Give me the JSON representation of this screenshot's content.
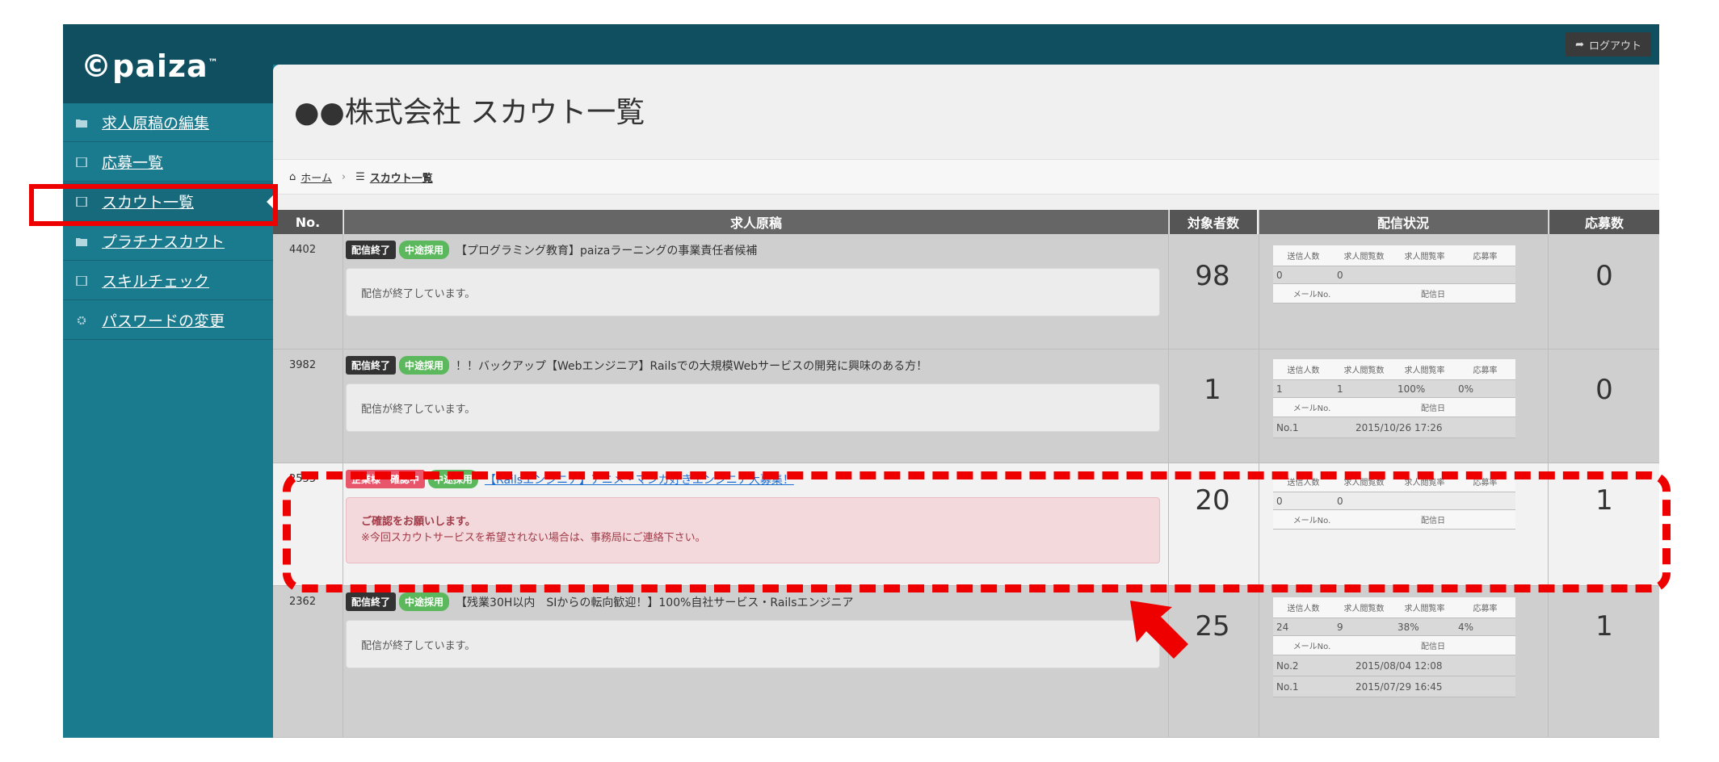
{
  "app": {
    "logo_text": "paiza",
    "logout_label": "ログアウト"
  },
  "sidebar": {
    "items": [
      {
        "label": "求人原稿の編集",
        "icon": "folder-icon"
      },
      {
        "label": "応募一覧",
        "icon": "list-icon"
      },
      {
        "label": "スカウト一覧",
        "icon": "list-icon"
      },
      {
        "label": "プラチナスカウト",
        "icon": "folder-icon"
      },
      {
        "label": "スキルチェック",
        "icon": "list-icon"
      },
      {
        "label": "パスワードの変更",
        "icon": "gear-icon"
      }
    ]
  },
  "page": {
    "title": "●●株式会社 スカウト一覧",
    "breadcrumb": {
      "home": "ホーム",
      "separator": "›",
      "current": "スカウト一覧"
    }
  },
  "table": {
    "headers": {
      "no": "No.",
      "job": "求人原稿",
      "targets": "対象者数",
      "delivery": "配信状況",
      "applications": "応募数"
    },
    "stat_headers": [
      "送信人数",
      "求人閲覧数",
      "求人閲覧率",
      "応募率"
    ],
    "stat_sub_headers": {
      "mail_no": "メールNo.",
      "date": "配信日"
    },
    "rows": [
      {
        "no": "4402",
        "badge1": "配信終了",
        "badge2": "中途採用",
        "title": "【プログラミング教育】paizaラーニングの事業責任者候補",
        "message": "配信が終了しています。",
        "targets": "98",
        "stats": [
          "0",
          "0",
          "",
          ""
        ],
        "history": [],
        "applications": "0"
      },
      {
        "no": "3982",
        "badge1": "配信終了",
        "badge2": "中途採用",
        "title": "！！バックアップ【Webエンジニア】Railsでの大規模Webサービスの開発に興味のある方！",
        "message": "配信が終了しています。",
        "targets": "1",
        "stats": [
          "1",
          "1",
          "100%",
          "0%"
        ],
        "history": [
          {
            "mail_no": "No.1",
            "date": "2015/10/26 17:26"
          }
        ],
        "applications": "0"
      },
      {
        "no": "2555",
        "badge1": "企業様　確認中",
        "badge2": "中途採用",
        "title": "【Railsエンジニア】アニメ・マンガ好きエンジニア大募集！",
        "message_bold": "ご確認をお願いします。",
        "message_note": "※今回スカウトサービスを希望されない場合は、事務局にご連絡下さい。",
        "targets": "20",
        "stats": [
          "0",
          "0",
          "",
          ""
        ],
        "history": [],
        "applications": "1"
      },
      {
        "no": "2362",
        "badge1": "配信終了",
        "badge2": "中途採用",
        "title": "【残業30H以内　SIからの転向歓迎！】100%自社サービス・Railsエンジニア",
        "message": "配信が終了しています。",
        "targets": "25",
        "stats": [
          "24",
          "9",
          "38%",
          "4%"
        ],
        "history": [
          {
            "mail_no": "No.2",
            "date": "2015/08/04 12:08"
          },
          {
            "mail_no": "No.1",
            "date": "2015/07/29 16:45"
          }
        ],
        "applications": "1"
      }
    ]
  },
  "colors": {
    "sidebar": "#1a7a8e",
    "topbar": "#0f4f60",
    "annotation": "#ee0000",
    "badge_end": "#333333",
    "badge_mid": "#5cb85c",
    "badge_confirm": "#e8566b"
  }
}
